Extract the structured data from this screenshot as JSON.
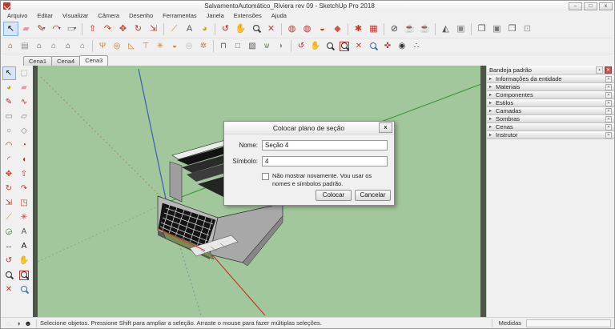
{
  "window": {
    "title": "SalvamentoAutomático_Riviera rev 09 - SketchUp Pro 2018",
    "controls": [
      {
        "name": "minimize-button",
        "glyph": "–"
      },
      {
        "name": "maximize-button",
        "glyph": "□"
      },
      {
        "name": "close-button",
        "glyph": "x"
      }
    ]
  },
  "menubar": {
    "items": [
      "Arquivo",
      "Editar",
      "Visualizar",
      "Câmera",
      "Desenho",
      "Ferramentas",
      "Janela",
      "Extensões",
      "Ajuda"
    ]
  },
  "toolbars": {
    "row1": [
      [
        {
          "n": "select-tool-icon",
          "g": "↖",
          "c": "#111111",
          "a": 1
        },
        {
          "n": "eraser-tool-icon",
          "g": "▰",
          "c": "#e096ac"
        },
        {
          "n": "line-tool-icon",
          "g": "✎",
          "c": "#a33226",
          "dd": 1
        },
        {
          "n": "arc-tool-icon",
          "g": "◠",
          "c": "#a33226",
          "dd": 1
        },
        {
          "n": "rectangle-tool-icon",
          "g": "▭",
          "c": "#7d7d7d",
          "dd": 1
        }
      ],
      [
        {
          "n": "pushpull-tool-icon",
          "g": "⇧",
          "c": "#c0392b"
        },
        {
          "n": "followme-tool-icon",
          "g": "↷",
          "c": "#c0392b"
        },
        {
          "n": "move-tool-icon",
          "g": "✥",
          "c": "#c0392b"
        },
        {
          "n": "rotate-tool-icon",
          "g": "↻",
          "c": "#c0392b"
        },
        {
          "n": "scale-tool-icon",
          "g": "⇲",
          "c": "#c0392b"
        }
      ],
      [
        {
          "n": "tape-measure-tool-icon",
          "g": "⟋",
          "c": "#b8901f"
        },
        {
          "n": "text-tool-icon",
          "g": "A",
          "c": "#555555"
        },
        {
          "n": "paint-bucket-tool-icon",
          "g": "◕",
          "c": "#c8a020"
        }
      ],
      [
        {
          "n": "orbit-tool-icon",
          "g": "↺",
          "c": "#b03030"
        },
        {
          "n": "pan-tool-icon",
          "g": "✋",
          "c": "#c9a227"
        },
        {
          "n": "zoom-tool-icon",
          "mag": "#333333"
        },
        {
          "n": "zoom-extents-tool-icon",
          "g": "✕",
          "c": "#c0392b"
        }
      ],
      [
        {
          "n": "section-plane-tool-icon",
          "g": "◍",
          "c": "#c0392b"
        },
        {
          "n": "display-section-planes-icon",
          "g": "◍",
          "c": "#b03030"
        },
        {
          "n": "display-section-cuts-icon",
          "g": "◒",
          "c": "#c0392b"
        },
        {
          "n": "section-fill-icon",
          "g": "◆",
          "c": "#c75b4e"
        }
      ],
      [
        {
          "n": "red-gear-tool-icon",
          "g": "✱",
          "c": "#d03020"
        },
        {
          "n": "red-grid-tool-icon",
          "g": "▦",
          "c": "#d03020"
        }
      ],
      [
        {
          "n": "xray-style-icon",
          "g": "⊘",
          "c": "#444444"
        },
        {
          "n": "shaded-style-icon",
          "g": "☕",
          "c": "#555555"
        },
        {
          "n": "textured-style-icon",
          "g": "☕",
          "c": "#8a8a8a"
        }
      ],
      [
        {
          "n": "shadows-toggle-icon",
          "g": "◭",
          "c": "#555555"
        },
        {
          "n": "fog-toggle-icon",
          "g": "▣",
          "c": "#8a8a8a"
        }
      ],
      [
        {
          "n": "tray-window-icon",
          "g": "❐",
          "c": "#555555"
        },
        {
          "n": "model-info-window-icon",
          "g": "▣",
          "c": "#777777"
        },
        {
          "n": "preferences-window-icon",
          "g": "❐",
          "c": "#555555"
        },
        {
          "n": "lock-icon",
          "g": "⊡",
          "c": "#9a9a9a"
        }
      ]
    ],
    "row2": [
      [
        {
          "n": "iso-view-icon",
          "g": "⌂",
          "c": "#7a4a2a"
        },
        {
          "n": "top-view-icon",
          "g": "▤",
          "c": "#8a8a8a"
        },
        {
          "n": "front-view-icon",
          "g": "⌂",
          "c": "#444444"
        },
        {
          "n": "right-view-icon",
          "g": "⌂",
          "c": "#6a6a6a"
        },
        {
          "n": "back-view-icon",
          "g": "⌂",
          "c": "#444444"
        },
        {
          "n": "left-view-icon",
          "g": "⌂",
          "c": "#6a6a6a"
        }
      ],
      [
        {
          "n": "sandbox-from-contours-icon",
          "g": "Ψ",
          "c": "#c87f2f"
        },
        {
          "n": "sandbox-from-scratch-icon",
          "g": "◎",
          "c": "#c87f2f"
        },
        {
          "n": "smoove-tool-icon",
          "g": "◺",
          "c": "#c87f2f"
        },
        {
          "n": "stamp-tool-icon",
          "g": "⊤",
          "c": "#c87f2f"
        },
        {
          "n": "drape-tool-icon",
          "g": "✳",
          "c": "#c87f2f"
        },
        {
          "n": "add-detail-tool-icon",
          "g": "◒",
          "c": "#c87f2f"
        },
        {
          "n": "flip-edge-tool-icon",
          "g": "◎",
          "c": "#bdbdbd"
        },
        {
          "n": "sandbox-extra-tool-icon",
          "g": "✲",
          "c": "#c87f2f"
        }
      ],
      [
        {
          "n": "advanced-camera-tool-icon",
          "g": "⊓",
          "c": "#555555"
        },
        {
          "n": "box-wireframe-tool-icon",
          "g": "□",
          "c": "#666666"
        },
        {
          "n": "box-solid-tool-icon",
          "g": "▧",
          "c": "#555555"
        },
        {
          "n": "vegetation-tool-icon",
          "g": "ѡ",
          "c": "#6a8a4a"
        },
        {
          "n": "shell-tool-icon",
          "g": "◗",
          "c": "#8a8a8a"
        }
      ],
      [
        {
          "n": "orbit-camera-icon",
          "g": "↺",
          "c": "#b03030"
        },
        {
          "n": "pan-camera-icon",
          "g": "✋",
          "c": "#c9a227"
        },
        {
          "n": "zoom-camera-icon",
          "mag": "#333333"
        },
        {
          "n": "zoom-window-icon",
          "mag": "#333333",
          "box": 1
        },
        {
          "n": "zoom-extents-icon",
          "g": "✕",
          "c": "#c0392b"
        },
        {
          "n": "previous-view-icon",
          "mag": "#3a6ea8"
        },
        {
          "n": "position-camera-icon",
          "g": "✜",
          "c": "#b03030"
        },
        {
          "n": "look-around-icon",
          "g": "◉",
          "c": "#333333"
        },
        {
          "n": "walk-tool-icon",
          "g": "∴",
          "c": "#222222"
        }
      ]
    ],
    "left": [
      {
        "n": "select-tool-icon",
        "g": "↖",
        "c": "#111111",
        "a": 1
      },
      {
        "n": "lasso-select-icon",
        "g": "▢",
        "c": "#b5b5b5"
      },
      {
        "n": "paint-bucket-icon",
        "g": "◕",
        "c": "#c8a020"
      },
      {
        "n": "eraser-icon",
        "g": "▰",
        "c": "#e096ac"
      },
      {
        "n": "line-tool-icon",
        "g": "✎",
        "c": "#a33226"
      },
      {
        "n": "freehand-tool-icon",
        "g": "∿",
        "c": "#a33226"
      },
      {
        "n": "rectangle-tool-icon",
        "g": "▭",
        "c": "#7d7d7d"
      },
      {
        "n": "rotated-rectangle-icon",
        "g": "▱",
        "c": "#7d7d7d"
      },
      {
        "n": "circle-tool-icon",
        "g": "○",
        "c": "#7d7d7d"
      },
      {
        "n": "polygon-tool-icon",
        "g": "◇",
        "c": "#7d7d7d"
      },
      {
        "n": "arc-tool-icon",
        "g": "◠",
        "c": "#a33226"
      },
      {
        "n": "pie-tool-icon",
        "g": "◔",
        "c": "#a33226"
      },
      {
        "n": "two-point-arc-icon",
        "g": "◜",
        "c": "#a33226"
      },
      {
        "n": "three-point-arc-icon",
        "g": "◖",
        "c": "#a33226"
      },
      {
        "n": "move-tool-icon",
        "g": "✥",
        "c": "#c0392b"
      },
      {
        "n": "pushpull-tool-icon",
        "g": "⇧",
        "c": "#c0392b"
      },
      {
        "n": "rotate-tool-icon",
        "g": "↻",
        "c": "#c0392b"
      },
      {
        "n": "followme-tool-icon",
        "g": "↷",
        "c": "#c0392b"
      },
      {
        "n": "scale-tool-icon",
        "g": "⇲",
        "c": "#c0392b"
      },
      {
        "n": "offset-tool-icon",
        "g": "◳",
        "c": "#c0392b"
      },
      {
        "n": "tape-measure-icon",
        "g": "⟋",
        "c": "#b8901f"
      },
      {
        "n": "axes-tool-icon",
        "g": "✳",
        "c": "#c0392b"
      },
      {
        "n": "protractor-tool-icon",
        "g": "◶",
        "c": "#3a7a3a"
      },
      {
        "n": "text-tool-icon",
        "g": "A",
        "c": "#555555"
      },
      {
        "n": "dimension-tool-icon",
        "g": "↔",
        "c": "#555555"
      },
      {
        "n": "3d-text-tool-icon",
        "g": "A",
        "c": "#111111"
      },
      {
        "n": "orbit-tool-icon",
        "g": "↺",
        "c": "#b03030"
      },
      {
        "n": "pan-tool-icon",
        "g": "✋",
        "c": "#c9a227"
      },
      {
        "n": "zoom-tool-icon",
        "mag": "#333333"
      },
      {
        "n": "zoom-window-icon",
        "mag": "#333333",
        "box": 1
      },
      {
        "n": "zoom-extents-icon",
        "g": "✕",
        "c": "#c0392b"
      },
      {
        "n": "previous-view-icon",
        "mag": "#3a6ea8"
      }
    ]
  },
  "scene_tabs": [
    {
      "label": "Cena1",
      "active": false
    },
    {
      "label": "Cena4",
      "active": false
    },
    {
      "label": "Cena3",
      "active": true
    }
  ],
  "dialog": {
    "title": "Colocar plano de seção",
    "close_glyph": "x",
    "name_label": "Nome:",
    "name_value": "Seção 4",
    "symbol_label": "Símbolo:",
    "symbol_value": "4",
    "checkbox_label": "Não mostrar novamente. Vou usar os nomes e símbolos padrão.",
    "checkbox_checked": false,
    "ok_label": "Colocar",
    "cancel_label": "Cancelar"
  },
  "right_panel": {
    "title": "Bandeja padrão",
    "sections": [
      "Informações da entidade",
      "Materiais",
      "Componentes",
      "Estilos",
      "Camadas",
      "Sombras",
      "Cenas",
      "Instrutor"
    ]
  },
  "statusbar": {
    "icons": [
      {
        "n": "geolocation-icon",
        "g": "◌",
        "c": "#aaaaaa"
      },
      {
        "n": "claim-credit-icon",
        "g": "◑",
        "c": "#555555"
      },
      {
        "n": "credits-icon",
        "g": "☻",
        "c": "#222222"
      }
    ],
    "message": "Selecione objetos. Pressione Shift para ampliar a seleção. Arraste o mouse para fazer múltiplas seleções.",
    "measures_label": "Medidas",
    "measures_value": ""
  },
  "colors": {
    "viewport_green": "#a3c79c",
    "viewport_frame": "#4d5748",
    "chrome": "#f0f0f0",
    "axis_red": "#c0392b",
    "axis_green": "#3f9a3f",
    "axis_blue": "#3a5fae",
    "tool_red": "#c0392b",
    "sandbox_orange": "#c87f2f"
  }
}
